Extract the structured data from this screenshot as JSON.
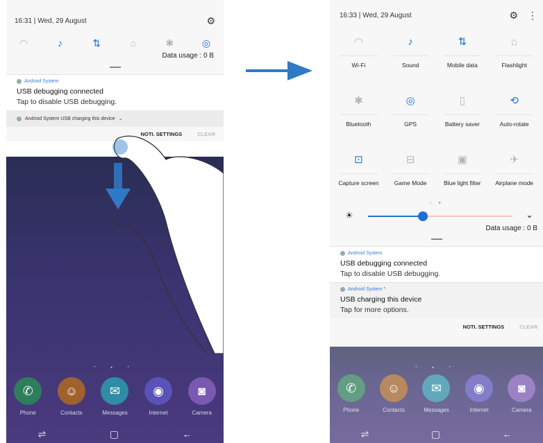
{
  "left": {
    "status": {
      "time": "16:31",
      "date": "Wed, 29 August"
    },
    "quick_icons": [
      "wifi-icon",
      "sound-icon",
      "mobile-data-icon",
      "flashlight-icon",
      "bluetooth-icon",
      "gps-icon"
    ],
    "data_usage": "Data usage : 0 B",
    "notif1": {
      "app": "Android System",
      "title": "USB debugging connected",
      "text": "Tap to disable USB debugging."
    },
    "notif2": {
      "line": "Android System USB charging this device"
    },
    "buttons": {
      "settings": "NOTI. SETTINGS",
      "clear": "CLEAR"
    },
    "apps": [
      {
        "label": "Phone",
        "color": "#2e7d5b",
        "glyph": "✆"
      },
      {
        "label": "Contacts",
        "color": "#a0622c",
        "glyph": "☺"
      },
      {
        "label": "Messages",
        "color": "#2e8ca6",
        "glyph": "✉"
      },
      {
        "label": "Internet",
        "color": "#5a52b8",
        "glyph": "◉"
      },
      {
        "label": "Camera",
        "color": "#7a59b2",
        "glyph": "◙"
      }
    ]
  },
  "right": {
    "status": {
      "time": "16:33",
      "date": "Wed, 29 August"
    },
    "tiles": [
      {
        "label": "Wi-Fi",
        "icon": "wifi-icon",
        "glyph": "◠",
        "active": false
      },
      {
        "label": "Sound",
        "icon": "sound-icon",
        "glyph": "♪",
        "active": true
      },
      {
        "label": "Mobile data",
        "icon": "mobile-data-icon",
        "glyph": "⇅",
        "active": true
      },
      {
        "label": "Flashlight",
        "icon": "flashlight-icon",
        "glyph": "⌂",
        "active": false
      },
      {
        "label": "Bluetooth",
        "icon": "bluetooth-icon",
        "glyph": "✱",
        "active": false
      },
      {
        "label": "GPS",
        "icon": "gps-icon",
        "glyph": "◎",
        "active": true
      },
      {
        "label": "Battery saver",
        "icon": "battery-saver-icon",
        "glyph": "▯",
        "active": false
      },
      {
        "label": "Auto-rotate",
        "icon": "auto-rotate-icon",
        "glyph": "⟲",
        "active": true
      },
      {
        "label": "Capture screen",
        "icon": "capture-screen-icon",
        "glyph": "⊡",
        "active": true
      },
      {
        "label": "Game Mode",
        "icon": "game-mode-icon",
        "glyph": "⊟",
        "active": false
      },
      {
        "label": "Blue light filter",
        "icon": "blue-light-filter-icon",
        "glyph": "▣",
        "active": false
      },
      {
        "label": "Airplane mode",
        "icon": "airplane-mode-icon",
        "glyph": "✈",
        "active": false
      }
    ],
    "brightness": 0.38,
    "data_usage": "Data usage : 0 B",
    "notif1": {
      "app": "Android System",
      "title": "USB debugging connected",
      "text": "Tap to disable USB debugging."
    },
    "notif2": {
      "app": "Android System ^",
      "title": "USB charging this device",
      "text": "Tap for more options."
    },
    "buttons": {
      "settings": "NOTI. SETTINGS",
      "clear": "CLEAR"
    },
    "apps": [
      {
        "label": "Phone",
        "color": "#2e7d5b",
        "glyph": "✆"
      },
      {
        "label": "Contacts",
        "color": "#a0622c",
        "glyph": "☺"
      },
      {
        "label": "Messages",
        "color": "#2e8ca6",
        "glyph": "✉"
      },
      {
        "label": "Internet",
        "color": "#5a52b8",
        "glyph": "◉"
      },
      {
        "label": "Camera",
        "color": "#7a59b2",
        "glyph": "◙"
      }
    ]
  },
  "colors": {
    "accent": "#1e6fd6",
    "arrow": "#2f7ac6"
  }
}
